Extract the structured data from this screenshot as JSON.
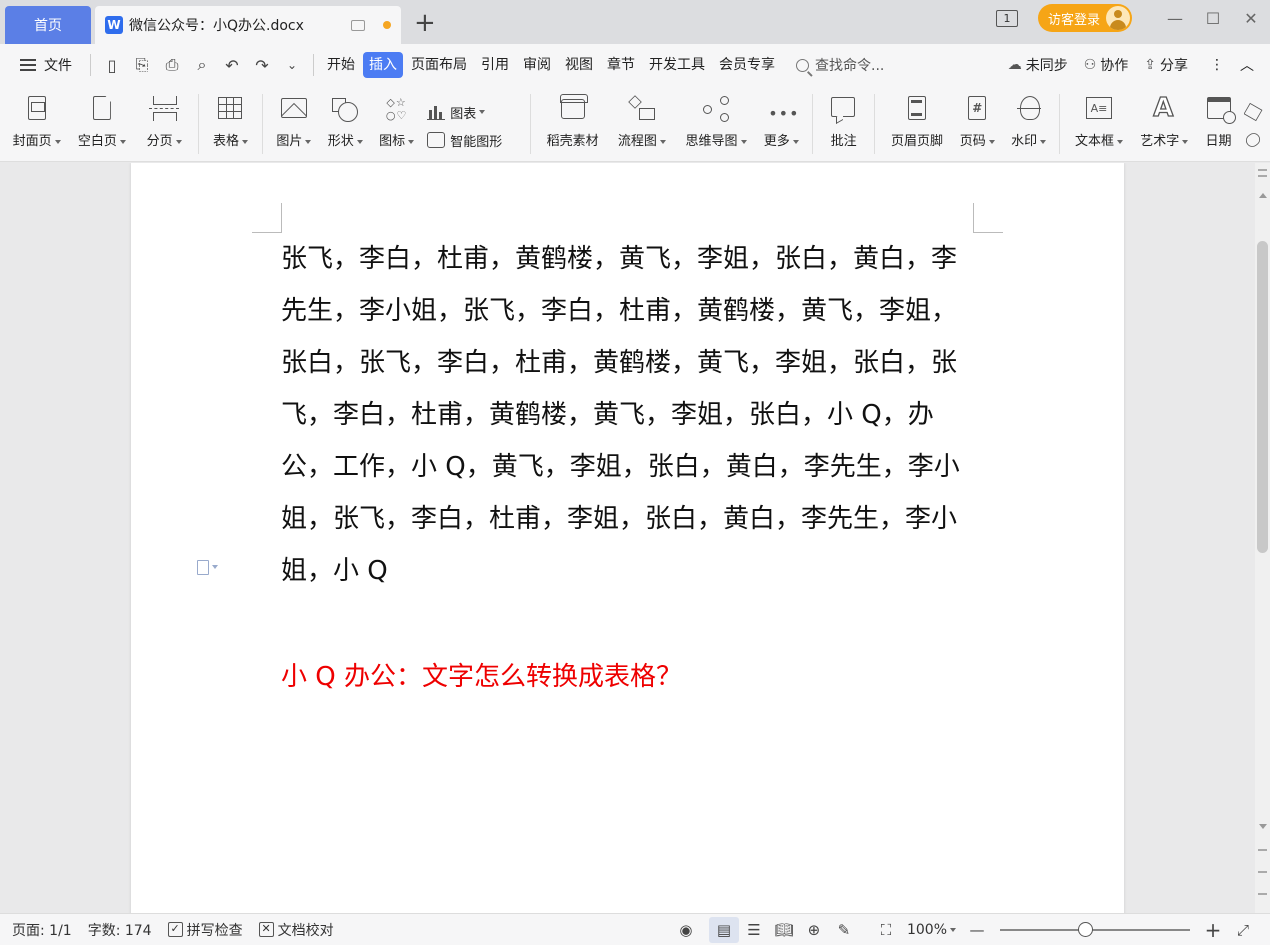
{
  "tabs": {
    "home": "首页",
    "doc_title": "微信公众号：小Q办公.docx",
    "doc_icon": "W",
    "add": "+"
  },
  "window": {
    "page_count_icon": "1",
    "login": "访客登录",
    "minimize": "—",
    "maximize": "☐",
    "close": "✕"
  },
  "menubar": {
    "file": "文件",
    "items": [
      "开始",
      "插入",
      "页面布局",
      "引用",
      "审阅",
      "视图",
      "章节",
      "开发工具",
      "会员专享"
    ],
    "active_index": 1,
    "search": "查找命令...",
    "unsynced": "未同步",
    "collab": "协作",
    "share": "分享",
    "more": "⋮",
    "collapse": "︿"
  },
  "ribbon": {
    "cover": "封面页",
    "blank": "空白页",
    "break": "分页",
    "table": "表格",
    "picture": "图片",
    "shape": "形状",
    "icon": "图标",
    "chart": "图表",
    "smart": "智能图形",
    "daoke": "稻壳素材",
    "flow": "流程图",
    "mind": "思维导图",
    "more": "更多",
    "comment": "批注",
    "header": "页眉页脚",
    "pagenum": "页码",
    "watermark": "水印",
    "textbox": "文本框",
    "wordart": "艺术字",
    "date": "日期",
    "pagenum_glyph": "#",
    "textbox_glyph": "A≡",
    "wordart_glyph": "A"
  },
  "document": {
    "body": "张飞，李白，杜甫，黄鹤楼，黄飞，李姐，张白，黄白，李先生，李小姐，张飞，李白，杜甫，黄鹤楼，黄飞，李姐，张白，张飞，李白，杜甫，黄鹤楼，黄飞，李姐，张白，张飞，李白，杜甫，黄鹤楼，黄飞，李姐，张白，小 Q，办公，工作，小 Q，黄飞，李姐，张白，黄白，李先生，李小姐，张飞，李白，杜甫，李姐，张白，黄白，李先生，李小姐，小 Q",
    "heading": "小 Q 办公：文字怎么转换成表格？"
  },
  "status": {
    "page": "页面: 1/1",
    "words": "字数: 174",
    "spell": "拼写检查",
    "proof": "文档校对",
    "zoom": "100%",
    "zoom_out": "—",
    "zoom_in": "+"
  },
  "colors": {
    "accent": "#4c7cf3",
    "login": "#f6a516",
    "heading": "#ee0000"
  }
}
